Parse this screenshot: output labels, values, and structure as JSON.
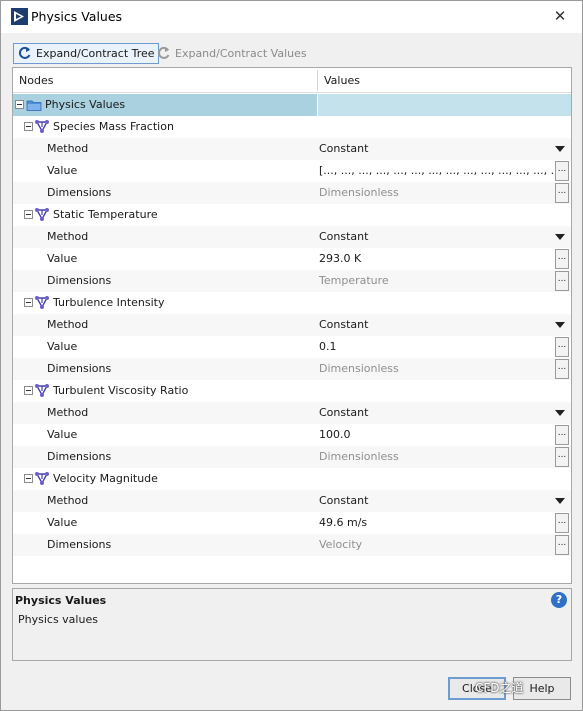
{
  "window": {
    "title": "Physics Values",
    "close_glyph": "✕"
  },
  "toolbar": {
    "expand_tree_label": "Expand/Contract Tree",
    "expand_values_label": "Expand/Contract Values"
  },
  "grid": {
    "header": {
      "nodes": "Nodes",
      "values": "Values"
    },
    "root": {
      "label": "Physics Values",
      "value": ""
    },
    "groups": [
      {
        "label": "Species Mass Fraction",
        "method": "Constant",
        "value": "[..., ..., ..., ..., ..., ..., ..., ..., ..., ..., ..., ..., ..., ...",
        "dimensions": "Dimensionless"
      },
      {
        "label": "Static Temperature",
        "method": "Constant",
        "value": "293.0 K",
        "dimensions": "Temperature"
      },
      {
        "label": "Turbulence Intensity",
        "method": "Constant",
        "value": "0.1",
        "dimensions": "Dimensionless"
      },
      {
        "label": "Turbulent Viscosity Ratio",
        "method": "Constant",
        "value": "100.0",
        "dimensions": "Dimensionless"
      },
      {
        "label": "Velocity Magnitude",
        "method": "Constant",
        "value": "49.6 m/s",
        "dimensions": "Velocity"
      }
    ],
    "labels": {
      "method": "Method",
      "value": "Value",
      "dimensions": "Dimensions"
    },
    "ellipsis_glyph": "..."
  },
  "description": {
    "title": "Physics Values",
    "text": "Physics values",
    "help_glyph": "?"
  },
  "buttons": {
    "close": "Close",
    "help": "Help"
  },
  "watermark": "CFD之道",
  "colors": {
    "selected_row": "#a9d1df",
    "accent_border": "#6f9cd0",
    "help_blue": "#2f6fc5"
  }
}
